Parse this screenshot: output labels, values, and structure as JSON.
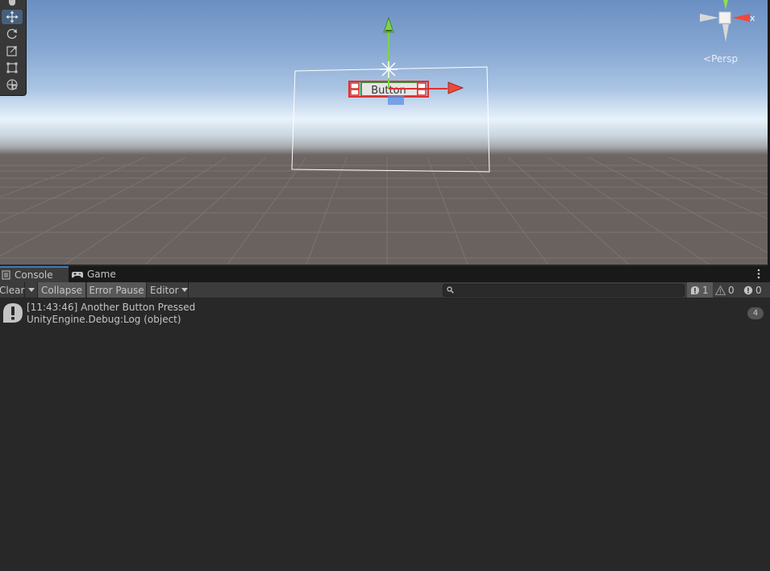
{
  "scene": {
    "persp_label": "Persp",
    "gizmo_axis_label": "x",
    "ui_button_label": "Button",
    "tools": [
      {
        "name": "hand-tool",
        "icon": "hand-icon"
      },
      {
        "name": "move-tool",
        "icon": "move-icon",
        "active": true
      },
      {
        "name": "rotate-tool",
        "icon": "rotate-icon"
      },
      {
        "name": "scale-tool",
        "icon": "scale-icon"
      },
      {
        "name": "rect-tool",
        "icon": "rect-icon"
      },
      {
        "name": "transform-tool",
        "icon": "transform-icon"
      }
    ]
  },
  "tabs": [
    {
      "label": "Console",
      "icon": "console-icon",
      "active": true
    },
    {
      "label": "Game",
      "icon": "gamepad-icon",
      "active": false
    }
  ],
  "console": {
    "toolbar": {
      "clear": "Clear",
      "collapse": "Collapse",
      "error_pause": "Error Pause",
      "editor": "Editor"
    },
    "search": {
      "value": "",
      "placeholder": ""
    },
    "counts": {
      "log": "1",
      "warning": "0",
      "error": "0"
    },
    "entries": [
      {
        "line1": "[11:43:46] Another Button Pressed",
        "line2": "UnityEngine.Debug:Log (object)",
        "count": "4",
        "icon": "info-icon"
      }
    ]
  },
  "colors": {
    "accent_tab": "#3a79bb",
    "panel_bg": "#282828",
    "toolbar_bg": "#3c3c3c",
    "active_tool": "#46607c",
    "gizmo_x": "#f0483a",
    "gizmo_y": "#8ee04a"
  }
}
